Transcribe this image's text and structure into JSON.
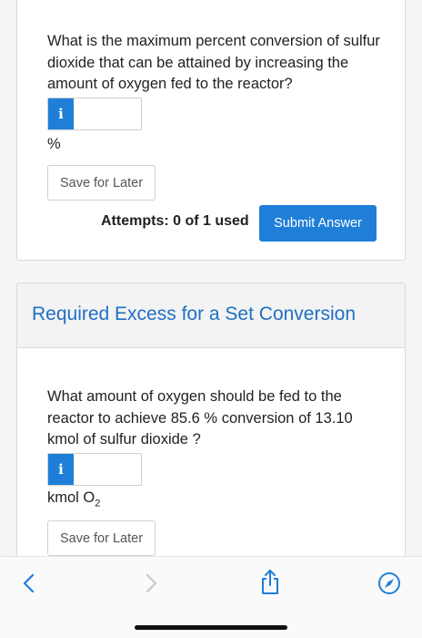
{
  "card1": {
    "question": "What is the maximum percent conversion of sulfur dioxide that can be attained by increasing the amount of oxygen fed to the reactor?",
    "info_badge": "i",
    "answer_value": "",
    "unit": "%",
    "save_label": "Save for Later",
    "attempts": "Attempts: 0 of 1 used",
    "submit_label": "Submit Answer"
  },
  "card2": {
    "title": "Required Excess for a Set Conversion",
    "question": "What amount of oxygen should be fed to the reactor to achieve 85.6 % conversion of 13.10 kmol of sulfur dioxide ?",
    "info_badge": "i",
    "answer_value": "",
    "unit_main": "kmol O",
    "unit_sub": "2",
    "save_label": "Save for Later"
  },
  "toolbar": {
    "icons": [
      "back-icon",
      "forward-icon",
      "share-icon",
      "compass-icon"
    ],
    "accent": "#1f7fd8",
    "disabled": "#c9c9c9"
  }
}
